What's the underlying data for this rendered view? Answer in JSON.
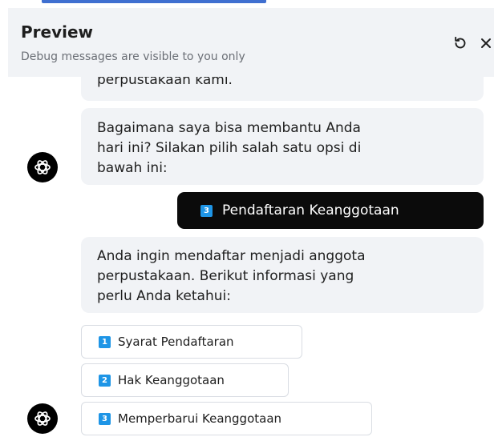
{
  "header": {
    "title": "Preview",
    "subtitle": "Debug messages are visible to you only",
    "refresh_icon": "refresh-icon",
    "close_icon": "close-icon"
  },
  "messages": {
    "bot_1_tail": "perpustakaan kami.",
    "bot_2": [
      "Bagaimana saya bisa membantu Anda",
      "hari ini? Silakan pilih salah satu opsi di",
      "bawah ini:"
    ],
    "user_choice": {
      "number": "3",
      "label": "Pendaftaran Keanggotaan"
    },
    "bot_3": [
      "Anda ingin mendaftar menjadi anggota",
      "perpustakaan. Berikut informasi yang",
      "perlu Anda ketahui:"
    ]
  },
  "options": [
    {
      "number": "1",
      "label": "Syarat Pendaftaran"
    },
    {
      "number": "2",
      "label": "Hak Keanggotaan"
    },
    {
      "number": "3",
      "label": "Memperbarui Keanggotaan"
    }
  ],
  "colors": {
    "header_bg": "#f1f3f6",
    "bubble_bg": "#f1f3f6",
    "user_bubble_bg": "#0b0b0b",
    "badge": "#1e95e6",
    "avatar": "#000000"
  },
  "icons": {
    "avatar": "openai-logo-icon"
  }
}
